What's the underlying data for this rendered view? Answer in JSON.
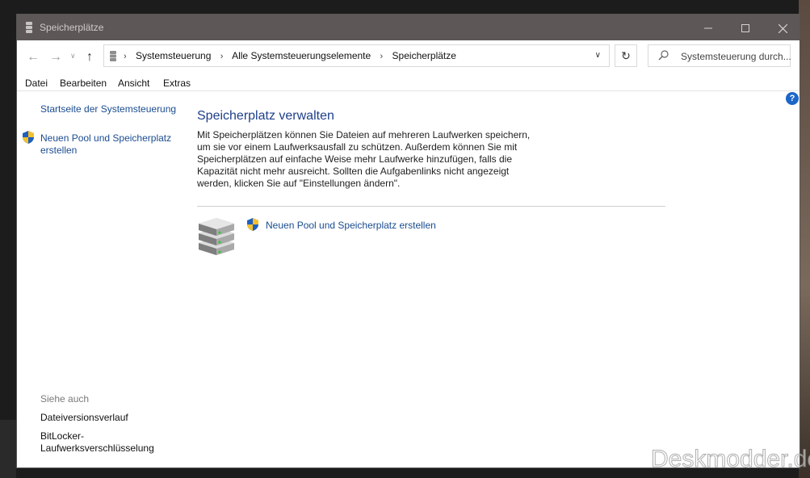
{
  "window": {
    "title": "Speicherplätze",
    "minimize_icon": "minimize-icon",
    "maximize_icon": "maximize-icon",
    "close_icon": "close-icon"
  },
  "address_bar": {
    "breadcrumbs": [
      "Systemsteuerung",
      "Alle Systemsteuerungselemente",
      "Speicherplätze"
    ],
    "search_placeholder": "Systemsteuerung durch..."
  },
  "menu": [
    "Datei",
    "Bearbeiten",
    "Ansicht",
    "Extras"
  ],
  "sidebar": {
    "home_link": "Startseite der Systemsteuerung",
    "create_link_line1": "Neuen Pool und Speicherplatz",
    "create_link_line2": "erstellen",
    "see_also_heading": "Siehe auch",
    "see_also": [
      "Dateiversionsverlauf",
      "BitLocker-",
      "Laufwerksverschlüsselung"
    ]
  },
  "main": {
    "title": "Speicherplatz verwalten",
    "description_lines": [
      "Mit Speicherplätzen können Sie Dateien auf mehreren Laufwerken speichern,",
      "um sie vor einem Laufwerksausfall zu schützen. Außerdem können Sie mit",
      "Speicherplätzen auf einfache Weise mehr Laufwerke hinzufügen, falls die",
      "Kapazität nicht mehr ausreicht. Sollten die Aufgabenlinks nicht angezeigt",
      "werden, klicken Sie auf \"Einstellungen ändern\"."
    ],
    "create_action": "Neuen Pool und Speicherplatz erstellen"
  },
  "watermark": "Deskmodder.de",
  "colors": {
    "link": "#1a4c90",
    "heading": "#1e3f8a",
    "titlebar": "#5e5757"
  }
}
